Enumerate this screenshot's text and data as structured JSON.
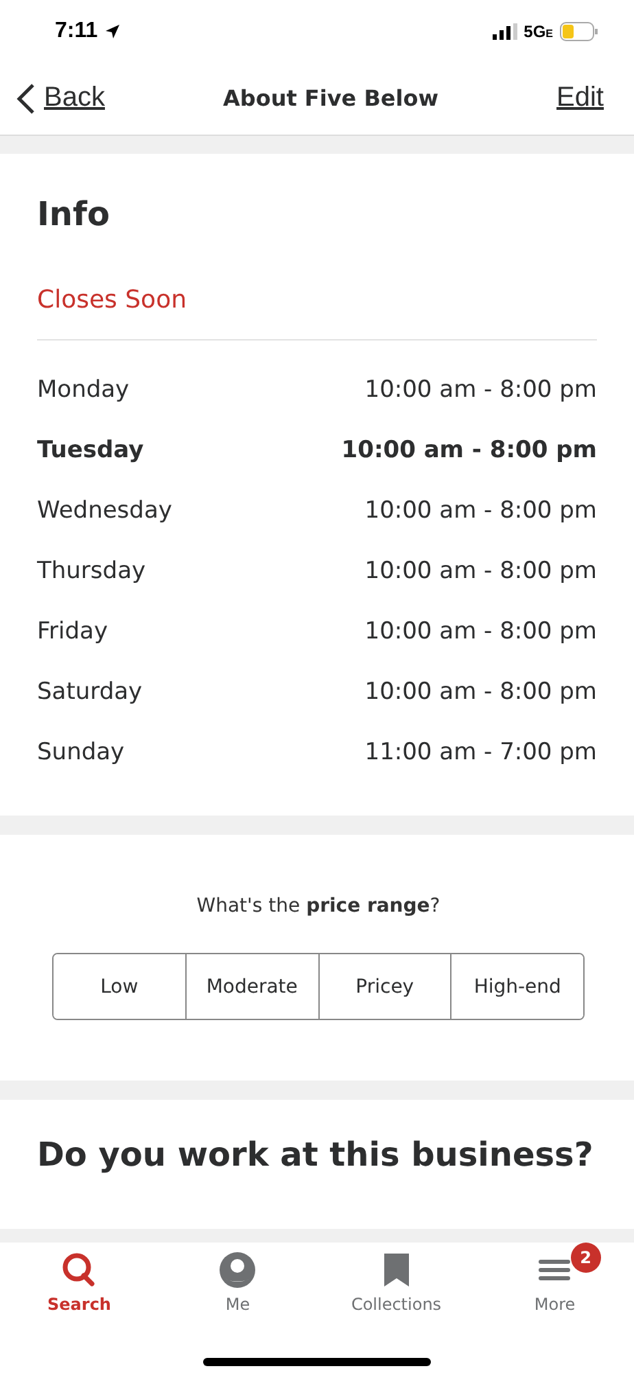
{
  "status_bar": {
    "time": "7:11",
    "network": "5G",
    "network_suffix": "E"
  },
  "nav": {
    "back": "Back",
    "title": "About Five Below",
    "action": "Edit"
  },
  "info": {
    "title": "Info",
    "status": "Closes Soon",
    "hours": [
      {
        "day": "Monday",
        "time": "10:00 am - 8:00 pm",
        "selected": false
      },
      {
        "day": "Tuesday",
        "time": "10:00 am - 8:00 pm",
        "selected": true
      },
      {
        "day": "Wednesday",
        "time": "10:00 am - 8:00 pm",
        "selected": false
      },
      {
        "day": "Thursday",
        "time": "10:00 am - 8:00 pm",
        "selected": false
      },
      {
        "day": "Friday",
        "time": "10:00 am - 8:00 pm",
        "selected": false
      },
      {
        "day": "Saturday",
        "time": "10:00 am - 8:00 pm",
        "selected": false
      },
      {
        "day": "Sunday",
        "time": "11:00 am - 7:00 pm",
        "selected": false
      }
    ]
  },
  "price_range": {
    "question": "What's the **price range**?",
    "options": [
      {
        "label": "Low",
        "selected": false
      },
      {
        "label": "Moderate",
        "selected": false
      },
      {
        "label": "Pricey",
        "selected": false
      },
      {
        "label": "High-end",
        "selected": false
      }
    ]
  },
  "claim": {
    "title": "Do you work at this business?"
  },
  "tab_bar": [
    {
      "label": "Search",
      "kind": "search",
      "selected": true
    },
    {
      "label": "Me",
      "kind": "me",
      "selected": false
    },
    {
      "label": "Collections",
      "kind": "collections",
      "selected": false
    },
    {
      "label": "More",
      "kind": "more",
      "selected": false,
      "badge": "2"
    }
  ]
}
